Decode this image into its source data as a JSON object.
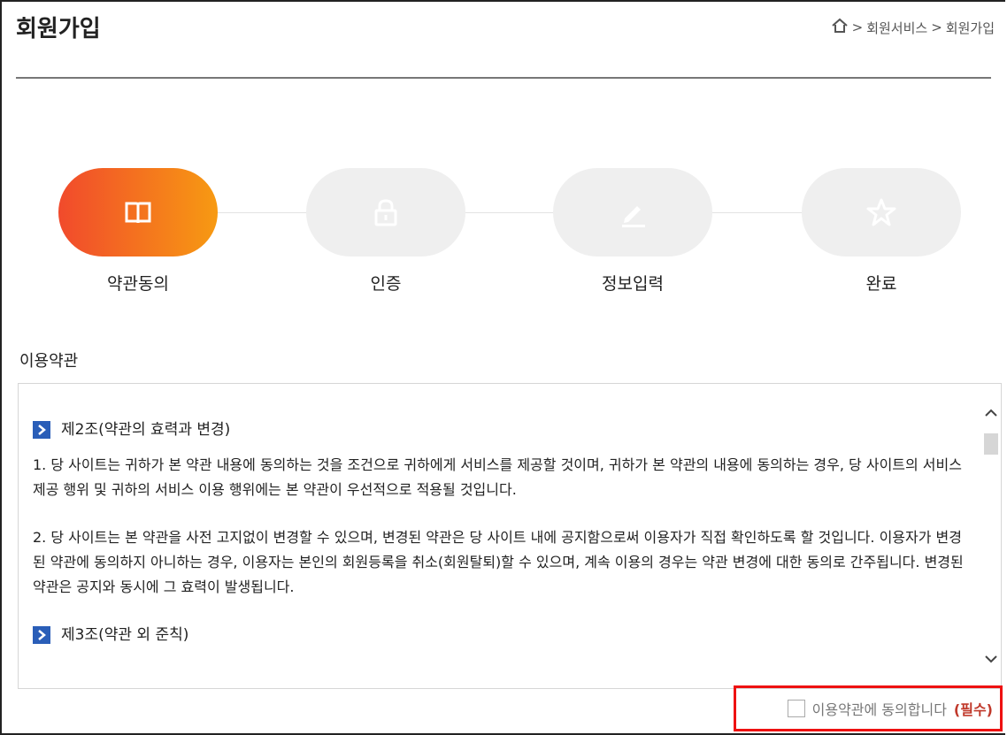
{
  "header": {
    "title": "회원가입",
    "breadcrumb": [
      "회원서비스",
      "회원가입"
    ],
    "home_icon": "home-icon"
  },
  "steps": [
    {
      "label": "약관동의",
      "icon": "book-icon",
      "active": true
    },
    {
      "label": "인증",
      "icon": "lock-icon",
      "active": false
    },
    {
      "label": "정보입력",
      "icon": "pencil-icon",
      "active": false
    },
    {
      "label": "완료",
      "icon": "star-icon",
      "active": false
    }
  ],
  "colors": {
    "active_start": "#f14a2c",
    "active_end": "#f79a12",
    "inactive": "#efefef",
    "article_arrow": "#2a5eb8",
    "required": "#c0392b",
    "highlight_border": "#ee1111"
  },
  "terms": {
    "section_label": "이용약관",
    "articles": [
      {
        "heading": "제2조(약관의 효력과 변경)",
        "paragraphs": [
          "1. 당 사이트는 귀하가 본 약관 내용에 동의하는 것을 조건으로 귀하에게 서비스를 제공할 것이며, 귀하가 본 약관의 내용에 동의하는 경우, 당 사이트의 서비스 제공 행위 및 귀하의 서비스 이용 행위에는 본 약관이 우선적으로 적용될 것입니다.",
          "2. 당 사이트는 본 약관을 사전 고지없이 변경할 수 있으며, 변경된 약관은 당 사이트 내에 공지함으로써 이용자가 직접 확인하도록 할 것입니다. 이용자가 변경된 약관에 동의하지 아니하는 경우, 이용자는 본인의 회원등록을 취소(회원탈퇴)할 수 있으며, 계속 이용의 경우는 약관 변경에 대한 동의로 간주됩니다. 변경된 약관은 공지와 동시에 그 효력이 발생됩니다."
        ]
      },
      {
        "heading": "제3조(약관 외 준칙)",
        "paragraphs": []
      }
    ]
  },
  "agree": {
    "label": "이용약관에 동의합니다",
    "required": "(필수)",
    "checked": false
  }
}
